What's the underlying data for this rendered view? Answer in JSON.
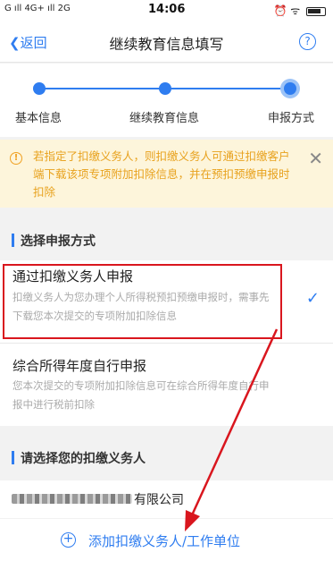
{
  "status_bar": {
    "left": "G ıll 4G+ ıll 2G",
    "time": "14:06",
    "right": "⏰ ᯤ"
  },
  "nav": {
    "back_label": "返回",
    "title": "继续教育信息填写",
    "help_label": "?"
  },
  "steps": [
    {
      "label": "基本信息",
      "state": "done"
    },
    {
      "label": "继续教育信息",
      "state": "done"
    },
    {
      "label": "申报方式",
      "state": "current"
    }
  ],
  "notice": {
    "icon": "!",
    "text": "若指定了扣缴义务人，则扣缴义务人可通过扣缴客户端下载该项专项附加扣除信息，并在预扣预缴申报时扣除",
    "close": "✕"
  },
  "section_method": {
    "title": "选择申报方式"
  },
  "options": [
    {
      "title": "通过扣缴义务人申报",
      "desc": "扣缴义务人为您办理个人所得税预扣预缴申报时，需事先下载您本次提交的专项附加扣除信息",
      "selected": true
    },
    {
      "title": "综合所得年度自行申报",
      "desc": "您本次提交的专项附加扣除信息可在综合所得年度自行申报中进行税前扣除",
      "selected": false
    }
  ],
  "check_mark": "✓",
  "section_withholder": {
    "title": "请选择您的扣缴义务人"
  },
  "company": {
    "name_suffix": "有限公司"
  },
  "add": {
    "icon": "+",
    "label": "添加扣缴义务人/工作单位"
  },
  "colors": {
    "accent": "#2f7df0",
    "annotation": "#d9161e",
    "notice_bg": "#fdf5db",
    "notice_text": "#e8a21e"
  }
}
